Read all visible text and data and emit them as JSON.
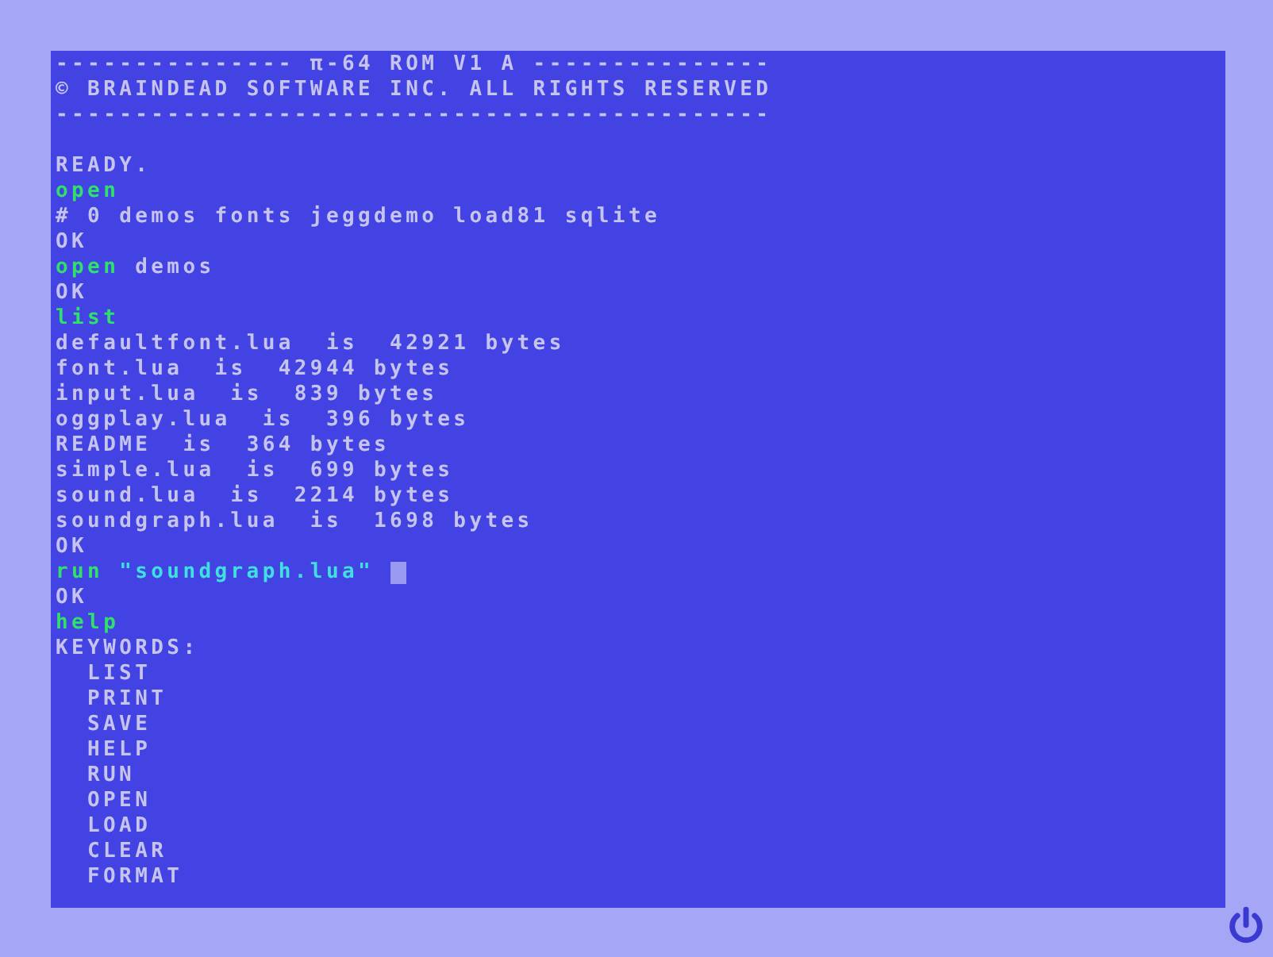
{
  "terminal": {
    "lines": [
      {
        "kind": "text",
        "segments": [
          {
            "kind": "output",
            "text": "--------------- π-64 ROM V1 A ---------------"
          }
        ]
      },
      {
        "kind": "text",
        "segments": [
          {
            "kind": "output",
            "text": "© BRAINDEAD SOFTWARE INC. ALL RIGHTS RESERVED"
          }
        ]
      },
      {
        "kind": "text",
        "segments": [
          {
            "kind": "output",
            "text": "---------------------------------------------"
          }
        ]
      },
      {
        "kind": "blank"
      },
      {
        "kind": "text",
        "segments": [
          {
            "kind": "output",
            "text": "READY."
          }
        ]
      },
      {
        "kind": "text",
        "segments": [
          {
            "kind": "command",
            "text": "open"
          }
        ]
      },
      {
        "kind": "text",
        "segments": [
          {
            "kind": "output",
            "text": "# 0 demos fonts jeggdemo load81 sqlite"
          }
        ]
      },
      {
        "kind": "text",
        "segments": [
          {
            "kind": "output",
            "text": "OK"
          }
        ]
      },
      {
        "kind": "text",
        "segments": [
          {
            "kind": "command",
            "text": "open"
          },
          {
            "kind": "output",
            "text": "demos"
          }
        ]
      },
      {
        "kind": "text",
        "segments": [
          {
            "kind": "output",
            "text": "OK"
          }
        ]
      },
      {
        "kind": "text",
        "segments": [
          {
            "kind": "command",
            "text": "list"
          }
        ]
      },
      {
        "kind": "text",
        "segments": [
          {
            "kind": "output",
            "text": "defaultfont.lua  is  42921 bytes"
          }
        ]
      },
      {
        "kind": "text",
        "segments": [
          {
            "kind": "output",
            "text": "font.lua  is  42944 bytes"
          }
        ]
      },
      {
        "kind": "text",
        "segments": [
          {
            "kind": "output",
            "text": "input.lua  is  839 bytes"
          }
        ]
      },
      {
        "kind": "text",
        "segments": [
          {
            "kind": "output",
            "text": "oggplay.lua  is  396 bytes"
          }
        ]
      },
      {
        "kind": "text",
        "segments": [
          {
            "kind": "output",
            "text": "README  is  364 bytes"
          }
        ]
      },
      {
        "kind": "text",
        "segments": [
          {
            "kind": "output",
            "text": "simple.lua  is  699 bytes"
          }
        ]
      },
      {
        "kind": "text",
        "segments": [
          {
            "kind": "output",
            "text": "sound.lua  is  2214 bytes"
          }
        ]
      },
      {
        "kind": "text",
        "segments": [
          {
            "kind": "output",
            "text": "soundgraph.lua  is  1698 bytes"
          }
        ]
      },
      {
        "kind": "text",
        "segments": [
          {
            "kind": "output",
            "text": "OK"
          }
        ]
      },
      {
        "kind": "text",
        "segments": [
          {
            "kind": "command",
            "text": "run"
          },
          {
            "kind": "string",
            "text": "\"soundgraph.lua\""
          },
          {
            "kind": "cursor"
          }
        ]
      },
      {
        "kind": "text",
        "segments": [
          {
            "kind": "output",
            "text": "OK"
          }
        ]
      },
      {
        "kind": "text",
        "segments": [
          {
            "kind": "command",
            "text": "help"
          }
        ]
      },
      {
        "kind": "text",
        "segments": [
          {
            "kind": "output",
            "text": "KEYWORDS:"
          }
        ],
        "children": [
          {
            "kind": "text",
            "segments": [
              {
                "kind": "output",
                "text": "LIST"
              }
            ]
          },
          {
            "kind": "text",
            "segments": [
              {
                "kind": "output",
                "text": "PRINT"
              }
            ]
          },
          {
            "kind": "text",
            "segments": [
              {
                "kind": "output",
                "text": "SAVE"
              }
            ]
          },
          {
            "kind": "text",
            "segments": [
              {
                "kind": "output",
                "text": "HELP"
              }
            ]
          },
          {
            "kind": "text",
            "segments": [
              {
                "kind": "output",
                "text": "RUN"
              }
            ]
          },
          {
            "kind": "text",
            "segments": [
              {
                "kind": "output",
                "text": "OPEN"
              }
            ]
          },
          {
            "kind": "text",
            "segments": [
              {
                "kind": "output",
                "text": "LOAD"
              }
            ]
          },
          {
            "kind": "text",
            "segments": [
              {
                "kind": "output",
                "text": "CLEAR"
              }
            ]
          },
          {
            "kind": "text",
            "segments": [
              {
                "kind": "output",
                "text": "FORMAT"
              }
            ]
          }
        ]
      }
    ]
  }
}
